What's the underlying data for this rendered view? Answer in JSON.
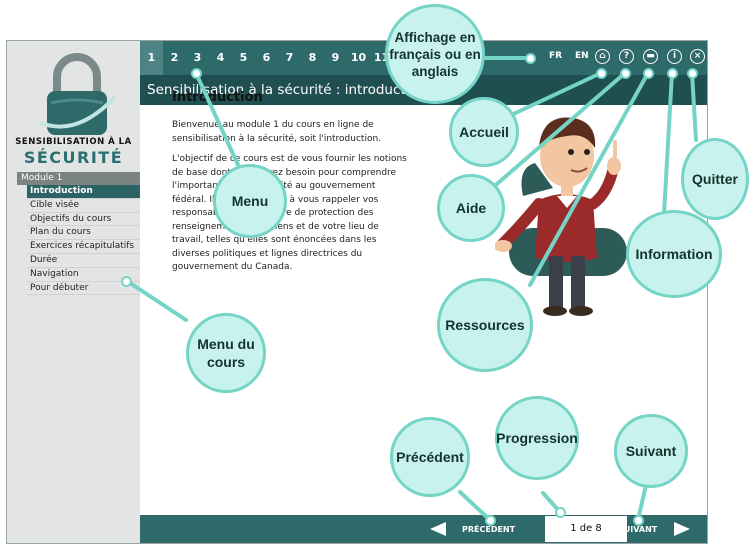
{
  "app": {
    "brand_line1": "SENSIBILISATION À LA",
    "brand_line2": "SÉCURITÉ",
    "module_label": "Module 1",
    "menu_items": [
      "Introduction",
      "Cible visée",
      "Objectifs du cours",
      "Plan du cours",
      "Exercices récapitulatifs",
      "Durée",
      "Navigation",
      "Pour débuter"
    ],
    "pages": [
      "1",
      "2",
      "3",
      "4",
      "5",
      "6",
      "7",
      "8",
      "9",
      "10",
      "11"
    ],
    "lang_fr": "FR",
    "lang_en": "EN",
    "page_title": "Sensibilisation à la sécurité : introduction",
    "content": {
      "heading": "Introduction",
      "p1": "Bienvenue au module 1 du cours en ligne de sensibilisation à la sécurité, soit l'introduction.",
      "p2": "L'objectif de ce cours est de vous fournir les notions de base dont vous aurez besoin pour comprendre l'importance de la sécurité au gouvernement fédéral. Il vise également à vous rappeler vos responsabilités en matière de protection des renseignements, des biens et de votre lieu de travail, telles qu'elles sont énoncées dans les diverses politiques et lignes directrices du gouvernement du Canada."
    },
    "prev_label": "PRÉCÉDENT",
    "progress_text": "1 de 8",
    "next_label": "SUIVANT"
  },
  "callouts": {
    "lang": "Affichage en français ou en anglais",
    "accueil": "Accueil",
    "aide": "Aide",
    "quitter": "Quitter",
    "menu": "Menu",
    "information": "Information",
    "ressources": "Ressources",
    "menu_cours": "Menu du cours",
    "precedent": "Précédent",
    "progression": "Progression",
    "suivant": "Suivant"
  },
  "colors": {
    "teal_dark": "#1f4f51",
    "teal": "#2f6a6b",
    "bubble_fill": "#c8f2ed",
    "bubble_border": "#74d4c6"
  }
}
